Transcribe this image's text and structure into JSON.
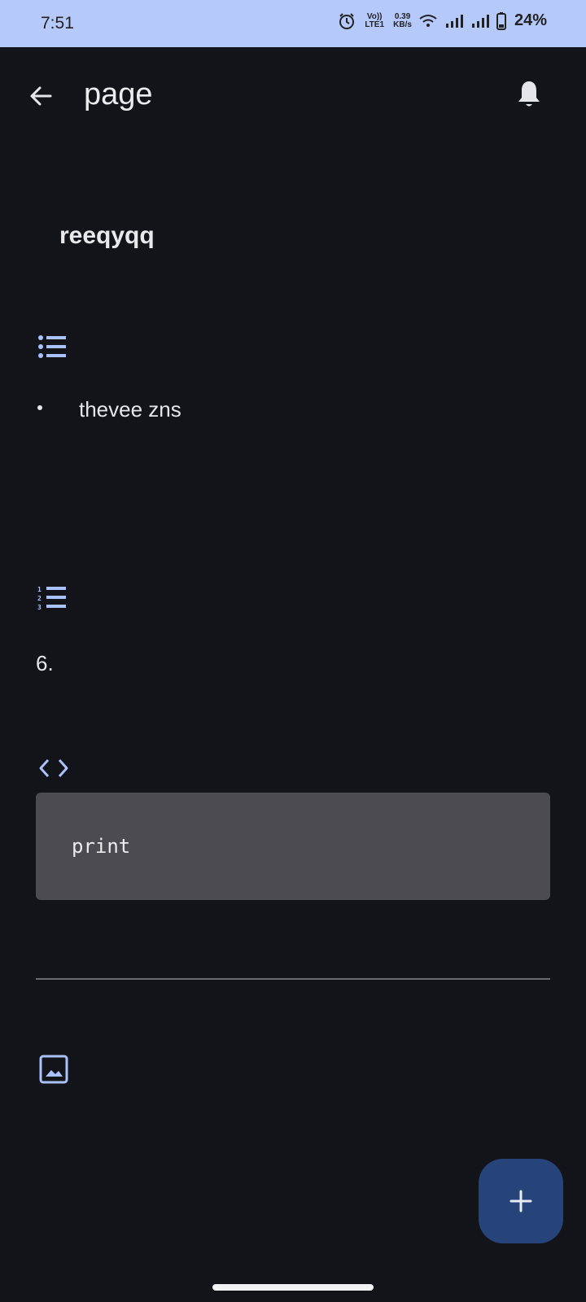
{
  "status_bar": {
    "time": "7:51",
    "volte_label": "Vo)) LTE1",
    "net_speed_value": "0.39",
    "net_speed_unit": "KB/s",
    "battery": "24%"
  },
  "app_bar": {
    "title": "page",
    "back_icon": "arrow-back-icon",
    "bell_icon": "bell-icon"
  },
  "content": {
    "heading": "reeqyqq",
    "bullet_list": {
      "icon": "bulleted-list-icon",
      "items": [
        {
          "text": "thevee zns"
        }
      ]
    },
    "numbered_list": {
      "icon": "numbered-list-icon",
      "items": [
        {
          "text": "6."
        }
      ]
    },
    "code_block": {
      "icon": "code-icon",
      "code": "print"
    },
    "image_block": {
      "icon": "image-icon"
    }
  },
  "fab": {
    "icon": "plus-icon"
  },
  "colors": {
    "status_bar_bg": "#b5c9fb",
    "background": "#131419",
    "accent_icon": "#a9c2fb",
    "code_bg": "#4b4b51",
    "fab_bg": "#264479"
  }
}
